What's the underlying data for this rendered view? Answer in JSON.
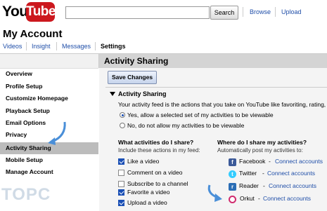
{
  "header": {
    "logo_you": "You",
    "logo_tube": "Tube",
    "search_value": "",
    "search_button": "Search",
    "links": [
      "Browse",
      "Upload"
    ]
  },
  "page": {
    "title": "My Account",
    "subnav": [
      "Videos",
      "Insight",
      "Messages",
      "Settings"
    ]
  },
  "sidebar": {
    "items": [
      "Overview",
      "Profile Setup",
      "Customize Homepage",
      "Playback Setup",
      "Email Options",
      "Privacy",
      "Activity Sharing",
      "Mobile Setup",
      "Manage Account"
    ],
    "active_index": 6
  },
  "main": {
    "title": "Activity Sharing",
    "save_button": "Save Changes",
    "section_title": "Activity Sharing",
    "description": "Your activity feed is the actions that you take on YouTube like favoriting, rating,",
    "radio_options": [
      {
        "label": "Yes, allow a selected set of my activities to be viewable",
        "checked": true
      },
      {
        "label": "No, do not allow my activities to be viewable",
        "checked": false
      }
    ],
    "share_what": {
      "heading": "What activities do I share?",
      "subtitle": "Include these actions in my feed:",
      "items": [
        {
          "label": "Like a video",
          "checked": true
        },
        {
          "label": "Comment on a video",
          "checked": false
        },
        {
          "label": "Subscribe to a channel",
          "checked": false
        },
        {
          "label": "Favorite a video",
          "checked": true
        },
        {
          "label": "Upload a video",
          "checked": true
        }
      ]
    },
    "share_where": {
      "heading": "Where do I share my activities?",
      "subtitle": "Automatically post my activities to:",
      "services": [
        {
          "name": "Facebook",
          "separator": "-",
          "link": "Connect accounts",
          "icon": "facebook-icon",
          "color": "#3b5998"
        },
        {
          "name": "Twitter",
          "separator": "-",
          "link": "Connect accounts",
          "icon": "twitter-icon",
          "color": "#33ccff"
        },
        {
          "name": "Reader",
          "separator": "-",
          "link": "Connect accounts",
          "icon": "google-reader-icon",
          "color": "#2a6db5"
        },
        {
          "name": "Orkut",
          "separator": "-",
          "link": "Connect accounts",
          "icon": "orkut-icon",
          "color": "#d02b6e"
        }
      ]
    }
  },
  "watermark": "TOPC",
  "colors": {
    "link": "#1f4ea8",
    "brand_red": "#cc181e",
    "arrow": "#4a8fd8"
  }
}
